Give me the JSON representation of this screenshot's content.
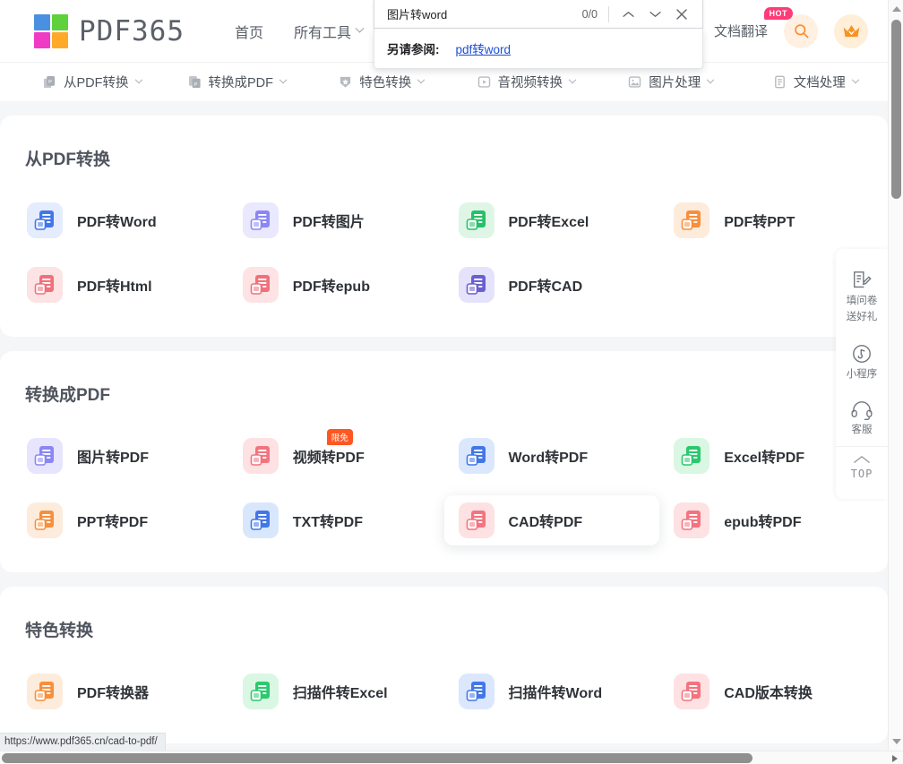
{
  "browser": {
    "status_url": "https://www.pdf365.cn/cad-to-pdf/",
    "find_bar": {
      "query": "图片转word",
      "match_count": "0/0",
      "prev_icon": "chevron-up-icon",
      "next_icon": "chevron-down-icon",
      "close_icon": "close-icon"
    },
    "find_suggestion": {
      "label": "另请参阅:",
      "link": "pdf转word"
    }
  },
  "header": {
    "brand": "PDF365",
    "nav": [
      {
        "label": "首页",
        "has_caret": false
      },
      {
        "label": "所有工具",
        "has_caret": true
      }
    ],
    "translate_label": "文档翻译",
    "hot_badge": "HOT",
    "search_icon": "search-icon",
    "vip_icon": "crown-icon"
  },
  "categories": [
    {
      "label": "从PDF转换",
      "icon": "pdf-convert-from-icon"
    },
    {
      "label": "转换成PDF",
      "icon": "pdf-convert-to-icon"
    },
    {
      "label": "特色转换",
      "icon": "star-shield-icon"
    },
    {
      "label": "音视频转换",
      "icon": "media-icon"
    },
    {
      "label": "图片处理",
      "icon": "image-icon"
    },
    {
      "label": "文档处理",
      "icon": "document-icon"
    }
  ],
  "sections": [
    {
      "title": "从PDF转换",
      "tools": [
        {
          "label": "PDF转Word",
          "icon": "doc-word-icon",
          "bg": "#e4ecfe",
          "fg": "#4277e8",
          "badge": ""
        },
        {
          "label": "PDF转图片",
          "icon": "doc-image-icon",
          "bg": "#e9e8fd",
          "fg": "#8b86f5",
          "badge": ""
        },
        {
          "label": "PDF转Excel",
          "icon": "doc-excel-icon",
          "bg": "#dff6e6",
          "fg": "#26c06a",
          "badge": ""
        },
        {
          "label": "PDF转PPT",
          "icon": "doc-ppt-icon",
          "bg": "#fdebdc",
          "fg": "#f78f3c",
          "badge": ""
        },
        {
          "label": "PDF转Html",
          "icon": "doc-html-icon",
          "bg": "#fde3e4",
          "fg": "#f1707a",
          "badge": ""
        },
        {
          "label": "PDF转epub",
          "icon": "doc-epub-icon",
          "bg": "#fde3e4",
          "fg": "#f1707a",
          "badge": ""
        },
        {
          "label": "PDF转CAD",
          "icon": "doc-cad-icon",
          "bg": "#e4e3fb",
          "fg": "#6a5fd0",
          "badge": ""
        }
      ]
    },
    {
      "title": "转换成PDF",
      "tools": [
        {
          "label": "图片转PDF",
          "icon": "image-to-pdf-icon",
          "bg": "#e6e5fd",
          "fg": "#8b86f5",
          "badge": ""
        },
        {
          "label": "视频转PDF",
          "icon": "video-to-pdf-icon",
          "bg": "#fde1e3",
          "fg": "#f4737f",
          "badge": "限免"
        },
        {
          "label": "Word转PDF",
          "icon": "word-to-pdf-icon",
          "bg": "#dbe7fd",
          "fg": "#4277e8",
          "badge": ""
        },
        {
          "label": "Excel转PDF",
          "icon": "excel-to-pdf-icon",
          "bg": "#d9f7e2",
          "fg": "#2bc96f",
          "badge": ""
        },
        {
          "label": "PPT转PDF",
          "icon": "ppt-to-pdf-icon",
          "bg": "#fdecdc",
          "fg": "#f78f3c",
          "badge": ""
        },
        {
          "label": "TXT转PDF",
          "icon": "txt-to-pdf-icon",
          "bg": "#d9e7fd",
          "fg": "#4277e8",
          "badge": ""
        },
        {
          "label": "CAD转PDF",
          "icon": "cad-to-pdf-icon",
          "bg": "#fde1e3",
          "fg": "#f4737f",
          "badge": "",
          "hovered": true
        },
        {
          "label": "epub转PDF",
          "icon": "epub-to-pdf-icon",
          "bg": "#fde1e3",
          "fg": "#f4737f",
          "badge": ""
        }
      ]
    },
    {
      "title": "特色转换",
      "tools": [
        {
          "label": "PDF转换器",
          "icon": "pdf-converter-icon",
          "bg": "#fdecdc",
          "fg": "#f78f3c",
          "badge": ""
        },
        {
          "label": "扫描件转Excel",
          "icon": "scan-excel-icon",
          "bg": "#d9f7e2",
          "fg": "#2bc96f",
          "badge": ""
        },
        {
          "label": "扫描件转Word",
          "icon": "scan-word-icon",
          "bg": "#dbe7fd",
          "fg": "#4277e8",
          "badge": ""
        },
        {
          "label": "CAD版本转换",
          "icon": "cad-version-icon",
          "bg": "#fde1e3",
          "fg": "#f4737f",
          "badge": ""
        }
      ]
    }
  ],
  "side_rail": [
    {
      "label_lines": [
        "填问卷",
        "送好礼"
      ],
      "icon": "survey-pen-icon"
    },
    {
      "label_lines": [
        "小程序"
      ],
      "icon": "miniprogram-icon"
    },
    {
      "label_lines": [
        "客服"
      ],
      "icon": "headset-icon"
    },
    {
      "label_lines": [
        "TOP"
      ],
      "icon": "chevron-up-icon"
    }
  ],
  "colors": {
    "page_bg": "#f5f6f8",
    "panel_bg": "#ffffff",
    "accent_orange": "#ff8c2b",
    "hot_pink": "#ff3b77",
    "limit_orange": "#ff5722",
    "link_blue": "#1a4fd6"
  }
}
